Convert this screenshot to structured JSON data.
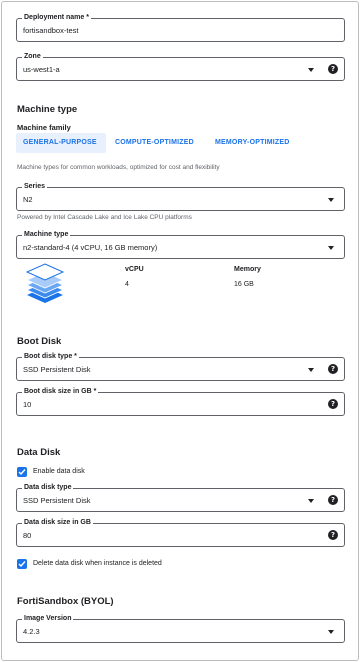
{
  "deployment": {
    "label": "Deployment name *",
    "value": "fortisandbox-test"
  },
  "zone": {
    "label": "Zone",
    "value": "us-west1-a"
  },
  "machine_type_section": {
    "title": "Machine type",
    "family_label": "Machine family",
    "tabs": [
      "GENERAL-PURPOSE",
      "COMPUTE-OPTIMIZED",
      "MEMORY-OPTIMIZED"
    ],
    "active_tab": "GENERAL-PURPOSE",
    "family_hint": "Machine types for common workloads, optimized for cost and flexibility",
    "series": {
      "label": "Series",
      "value": "N2",
      "hint": "Powered by Intel Cascade Lake and Ice Lake CPU platforms"
    },
    "machine_type": {
      "label": "Machine type",
      "value": "n2-standard-4 (4 vCPU, 16 GB memory)"
    },
    "specs": {
      "vcpu_label": "vCPU",
      "vcpu_value": "4",
      "memory_label": "Memory",
      "memory_value": "16 GB"
    }
  },
  "boot_disk": {
    "title": "Boot Disk",
    "type_label": "Boot disk type *",
    "type_value": "SSD Persistent Disk",
    "size_label": "Boot disk size in GB *",
    "size_value": "10"
  },
  "data_disk": {
    "title": "Data Disk",
    "enable_label": "Enable data disk",
    "enable_checked": true,
    "type_label": "Data disk type",
    "type_value": "SSD Persistent Disk",
    "size_label": "Data disk size in GB",
    "size_value": "80",
    "delete_label": "Delete data disk when instance is deleted",
    "delete_checked": true
  },
  "fortisandbox": {
    "title": "FortiSandbox (BYOL)",
    "image_label": "Image Version",
    "image_value": "4.2.3"
  },
  "colors": {
    "accent": "#1a73e8",
    "tab_active_bg": "#e8f0fe",
    "border": "#5f6368",
    "text": "#202124",
    "hint": "#5f6368"
  },
  "icons": {
    "dropdown": "caret-down-icon",
    "help": "help-circle-icon",
    "machine": "layers-icon",
    "check": "check-icon"
  }
}
